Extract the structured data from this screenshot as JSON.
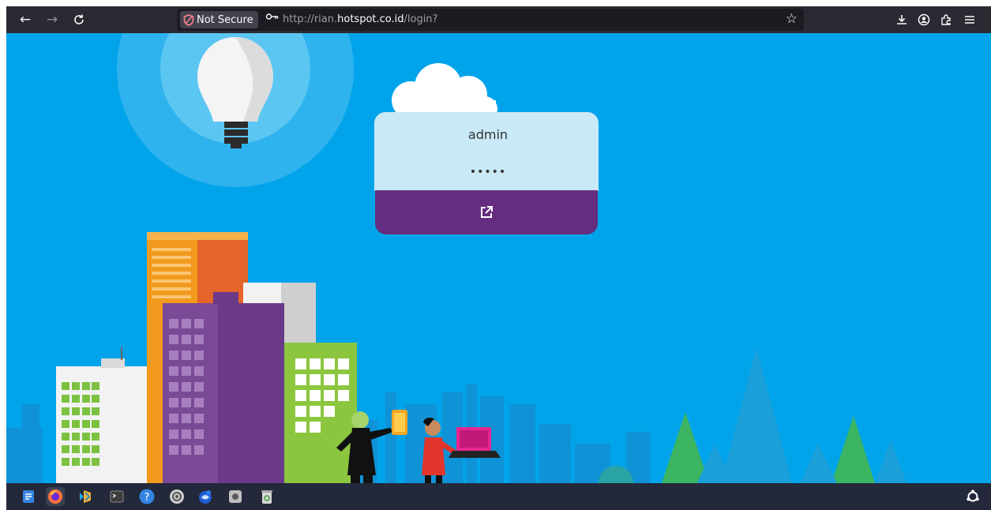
{
  "browser": {
    "nav": {
      "back_icon": "←",
      "forward_icon": "→",
      "reload_icon": "C"
    },
    "security_label": "Not Secure",
    "url": {
      "scheme": "http://rian.",
      "host": "hotspot.co.id",
      "path": "/login?"
    },
    "toolbar_icons": [
      "bookmark-star-icon",
      "downloads-icon",
      "account-icon",
      "extensions-icon",
      "menu-icon"
    ]
  },
  "login": {
    "username_value": "admin",
    "password_value": "•••••",
    "submit_icon": "external-link-icon"
  },
  "colors": {
    "page_background": "#01a4ea",
    "login_fields_background": "#c9e9f7",
    "login_button": "#652d80",
    "browser_chrome": "#2b2a33",
    "taskbar": "#23293a"
  },
  "taskbar": {
    "apps": [
      "text-editor-icon",
      "firefox-icon",
      "vscode-icon",
      "terminal-icon",
      "help-icon",
      "settings-icon",
      "thunderbird-icon",
      "app-icon",
      "trash-icon"
    ],
    "tray": [
      "ubuntu-logo-icon"
    ]
  }
}
